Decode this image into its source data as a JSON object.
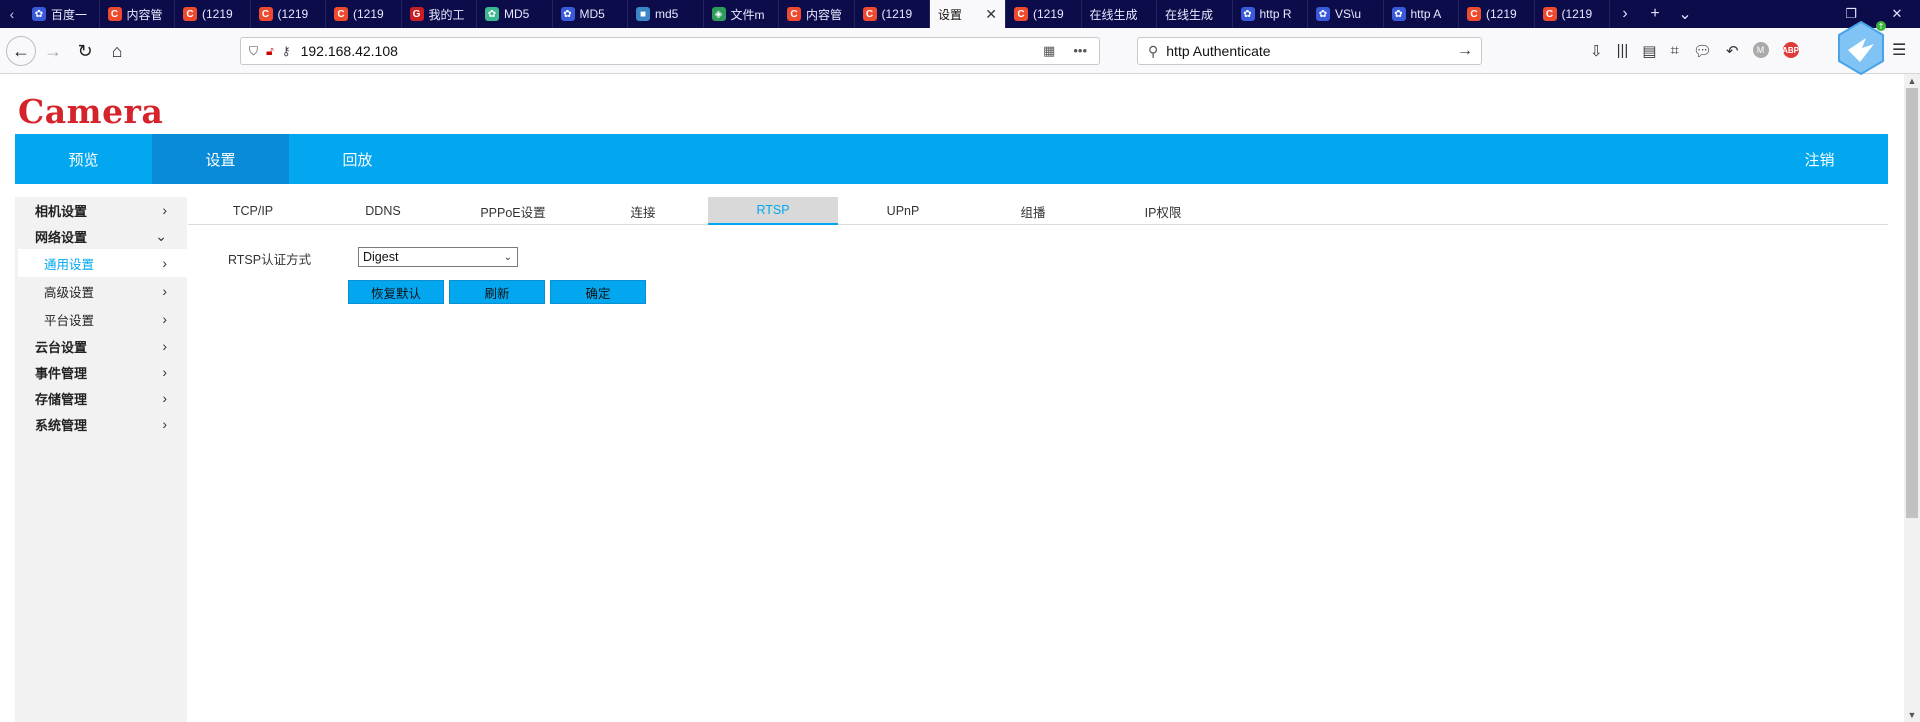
{
  "browser": {
    "tabs": [
      {
        "title": "百度一",
        "favicon": "baidu-paw-icon",
        "color": "#3a5bd9"
      },
      {
        "title": "内容管",
        "favicon": "csdn-c-icon",
        "color": "#f04a2e"
      },
      {
        "title": "(1219",
        "favicon": "csdn-c-icon",
        "color": "#f04a2e"
      },
      {
        "title": "(1219",
        "favicon": "csdn-c-icon",
        "color": "#f04a2e"
      },
      {
        "title": "(1219",
        "favicon": "csdn-c-icon",
        "color": "#f04a2e"
      },
      {
        "title": "我的工",
        "favicon": "gitee-g-icon",
        "color": "#c71d23"
      },
      {
        "title": "MD5",
        "favicon": "flower-icon",
        "color": "#3bb88f"
      },
      {
        "title": "MD5",
        "favicon": "baidu-paw-icon",
        "color": "#3a5bd9"
      },
      {
        "title": "md5",
        "favicon": "md5-site-icon",
        "color": "#3b86c6"
      },
      {
        "title": "文件m",
        "favicon": "shield-file-icon",
        "color": "#2e9d5b"
      },
      {
        "title": "内容管",
        "favicon": "csdn-c-icon",
        "color": "#f04a2e"
      },
      {
        "title": "(1219",
        "favicon": "csdn-c-icon",
        "color": "#f04a2e"
      },
      {
        "title": "设置",
        "favicon": "",
        "color": ""
      },
      {
        "title": "(1219",
        "favicon": "csdn-c-icon",
        "color": "#f04a2e"
      },
      {
        "title": "在线生成",
        "favicon": "",
        "color": ""
      },
      {
        "title": "在线生成",
        "favicon": "",
        "color": ""
      },
      {
        "title": "http R",
        "favicon": "baidu-paw-icon",
        "color": "#3a5bd9"
      },
      {
        "title": "VS\\u",
        "favicon": "baidu-paw-icon",
        "color": "#3a5bd9"
      },
      {
        "title": "http A",
        "favicon": "baidu-paw-icon",
        "color": "#3a5bd9"
      },
      {
        "title": "(1219",
        "favicon": "csdn-c-icon",
        "color": "#f04a2e"
      },
      {
        "title": "(1219",
        "favicon": "csdn-c-icon",
        "color": "#f04a2e"
      }
    ],
    "active_tab_index": 12,
    "url": "192.168.42.108",
    "search_text": "http  Authenticate"
  },
  "app": {
    "logo": "Camera",
    "brand_color": "#d5232b",
    "accent_color": "#02a7f0",
    "nav": {
      "preview": "预览",
      "settings": "设置",
      "playback": "回放",
      "logout": "注销"
    },
    "sidebar": {
      "camera": "相机设置",
      "network": "网络设置",
      "general": "通用设置",
      "advanced": "高级设置",
      "platform": "平台设置",
      "ptz": "云台设置",
      "event": "事件管理",
      "storage": "存储管理",
      "system": "系统管理"
    },
    "subtabs": {
      "tcpip": "TCP/IP",
      "ddns": "DDNS",
      "pppoe": "PPPoE设置",
      "connect": "连接",
      "rtsp": "RTSP",
      "upnp": "UPnP",
      "multicast": "组播",
      "ipperm": "IP权限"
    },
    "form": {
      "auth_label": "RTSP认证方式",
      "auth_value": "Digest",
      "restore": "恢复默认",
      "refresh": "刷新",
      "confirm": "确定"
    }
  }
}
